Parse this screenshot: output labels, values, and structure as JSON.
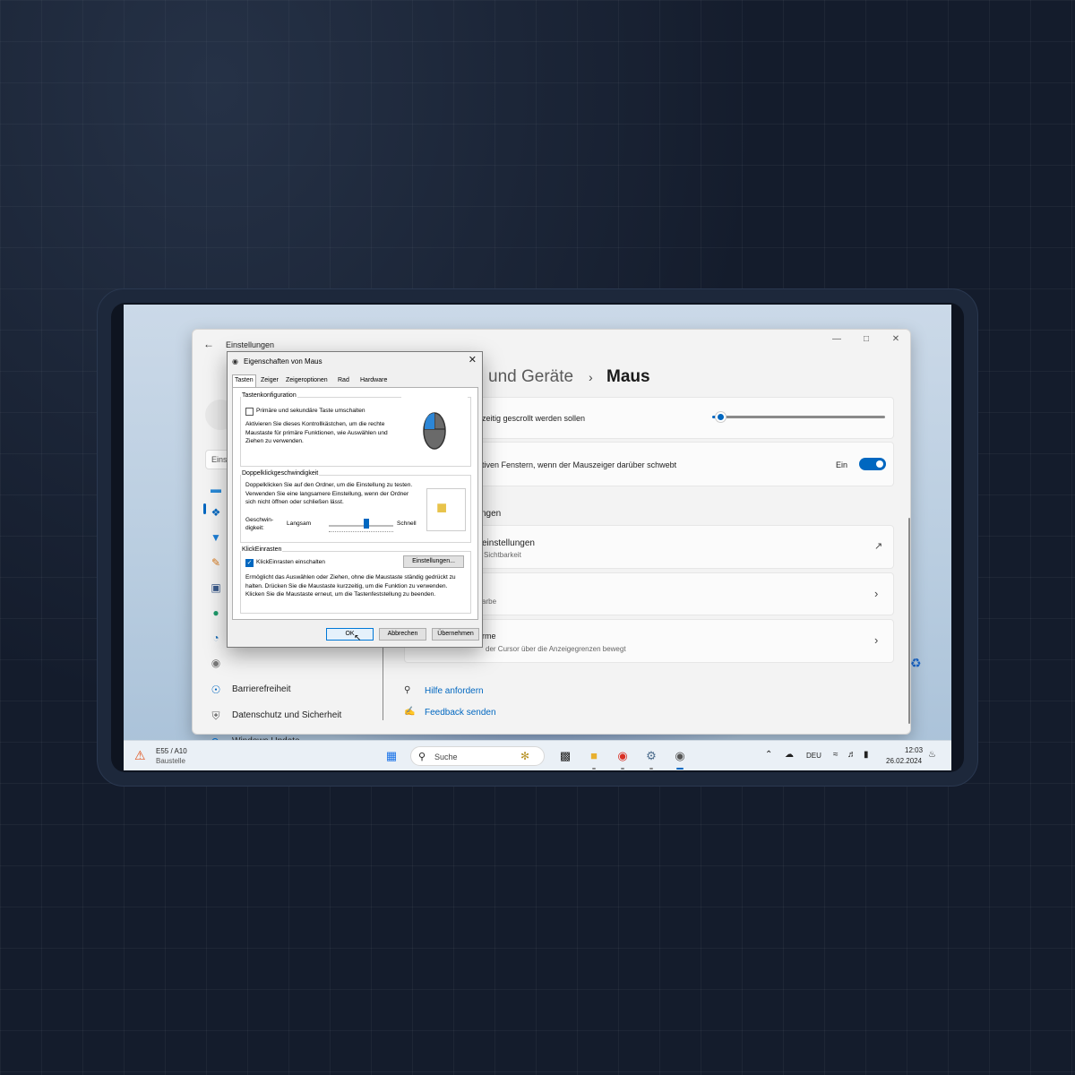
{
  "settings": {
    "title": "Einstellungen",
    "search_stub": "Eins",
    "breadcrumb_parent": "und Geräte",
    "breadcrumb_current": "Maus",
    "sidebar": [
      {
        "label": "Barrierefreiheit",
        "icon": "accessibility-icon"
      },
      {
        "label": "Datenschutz und Sicherheit",
        "icon": "shield-icon"
      },
      {
        "label": "Windows Update",
        "icon": "windows-update-icon"
      }
    ],
    "card_scroll": "zeitig gescrollt werden sollen",
    "card_inactive": "tiven Fenstern, wenn der Mauszeiger darüber schwebt",
    "toggle_label": "Ein",
    "section_related": "ngen",
    "card_additional_title": "einstellungen",
    "card_additional_sub": "Sichtbarkeit",
    "card_pointer_sub": "arbe",
    "card_multimon_title": "rme",
    "card_multimon_sub": "der Cursor über die Anzeigegrenzen bewegt",
    "help_link": "Hilfe anfordern",
    "feedback_link": "Feedback senden"
  },
  "dialog": {
    "title": "Eigenschaften von Maus",
    "tabs": [
      "Tasten",
      "Zeiger",
      "Zeigeroptionen",
      "Rad",
      "Hardware"
    ],
    "group1_title": "Tastenkonfiguration",
    "swap_label": "Primäre und sekundäre Taste umschalten",
    "swap_desc": "Aktivieren Sie dieses Kontrollkästchen, um die rechte Maustaste für primäre Funktionen, wie Auswählen und Ziehen zu verwenden.",
    "group2_title": "Doppelklickgeschwindigkeit",
    "dbl_desc": "Doppelklicken Sie auf den Ordner, um die Einstellung zu testen. Verwenden Sie eine langsamere Einstellung, wenn der Ordner sich nicht öffnen oder schließen lässt.",
    "speed_label_1": "Geschwin-",
    "speed_label_2": "digkeit:",
    "slow": "Langsam",
    "fast": "Schnell",
    "group3_title": "KlickEinrasten",
    "clicklock_label": "KlickEinrasten einschalten",
    "settings_button": "Einstellungen...",
    "clicklock_desc": "Ermöglicht das Auswählen oder Ziehen, ohne die Maustaste ständig gedrückt zu halten. Drücken Sie die Maustaste kurzzeitig, um die Funktion zu verwenden. Klicken Sie die Maustaste erneut, um die Tastenfeststellung zu beenden.",
    "ok": "OK",
    "cancel": "Abbrechen",
    "apply": "Übernehmen"
  },
  "taskbar": {
    "weather_title": "E55 / A10",
    "weather_sub": "Baustelle",
    "search_placeholder": "Suche",
    "lang": "DEU",
    "time": "12:03",
    "date": "26.02.2024"
  },
  "colors": {
    "accent": "#0067c0",
    "background": "#141c2c"
  }
}
